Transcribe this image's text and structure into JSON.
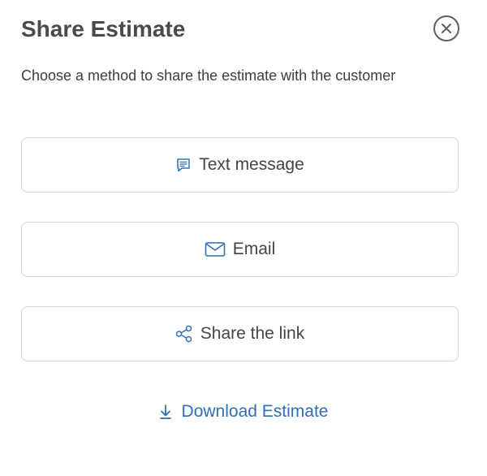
{
  "dialog": {
    "title": "Share Estimate",
    "subtitle": "Choose a method to share the estimate with the customer",
    "close_icon": "close-circle-icon"
  },
  "share_options": [
    {
      "label": "Text message",
      "icon": "message-icon"
    },
    {
      "label": "Email",
      "icon": "envelope-icon"
    },
    {
      "label": "Share the link",
      "icon": "share-icon"
    }
  ],
  "download": {
    "label": "Download Estimate",
    "icon": "download-icon"
  },
  "colors": {
    "accent": "#2f6fb5",
    "text": "#454545",
    "border": "#d6d6d6"
  }
}
